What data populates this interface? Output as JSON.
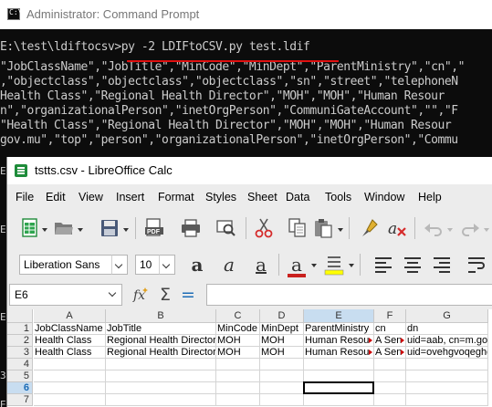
{
  "cmd": {
    "title": "Administrator: Command Prompt",
    "prompt": "E:\\test\\ldiftocsv>",
    "command": "py -2 LDIFtoCSV.py test.ldif",
    "output": [
      "\"JobClassName\",\"JobTitle\",\"MinCode\",\"MinDept\",\"ParentMinistry\",\"cn\",\"",
      ",\"objectclass\",\"objectclass\",\"objectclass\",\"sn\",\"street\",\"telephoneN",
      "Health Class\",\"Regional Health Director\",\"MOH\",\"MOH\",\"Human Resour",
      "n\",\"organizationalPerson\",\"inetOrgPerson\",\"CommuniGateAccount\",\"\",\"F",
      "\"Health Class\",\"Regional Health Director\",\"MOH\",\"MOH\",\"Human Resour",
      "gov.mu\",\"top\",\"person\",\"organizationalPerson\",\"inetOrgPerson\",\"Commu"
    ],
    "edge_chars": [
      "E",
      "",
      "",
      "",
      "E",
      "",
      "",
      "",
      "",
      "",
      "E",
      "",
      "",
      "",
      "3",
      "",
      "E"
    ]
  },
  "calc": {
    "title": "tstts.csv - LibreOffice Calc",
    "menu": [
      "File",
      "Edit",
      "View",
      "Insert",
      "Format",
      "Styles",
      "Sheet",
      "Data",
      "Tools",
      "Window",
      "Help"
    ],
    "font_name": "Liberation Sans",
    "font_size": "10",
    "name_box": "E6",
    "formula": "",
    "columns": [
      "A",
      "B",
      "C",
      "D",
      "E",
      "F",
      "G"
    ],
    "active_column": "E",
    "rows": [
      "1",
      "2",
      "3",
      "4",
      "5",
      "6",
      "7"
    ],
    "active_row": "6",
    "selected_cell": "E6",
    "cells": [
      [
        "JobClassName",
        "JobTitle",
        "MinCode",
        "MinDept",
        "ParentMinistry",
        "cn",
        "dn"
      ],
      [
        "Health Class",
        "Regional Health Director",
        "MOH",
        "MOH",
        "Human Resou",
        "A Sen",
        "uid=aab, cn=m.gov"
      ],
      [
        "Health Class",
        "Regional Health Director",
        "MOH",
        "MOH",
        "Human Resou",
        "A Sen",
        "uid=ovehgvoqeghe"
      ],
      [
        "",
        "",
        "",
        "",
        "",
        "",
        ""
      ],
      [
        "",
        "",
        "",
        "",
        "",
        "",
        ""
      ],
      [
        "",
        "",
        "",
        "",
        "",
        "",
        ""
      ],
      [
        "",
        "",
        "",
        "",
        "",
        "",
        ""
      ]
    ]
  }
}
